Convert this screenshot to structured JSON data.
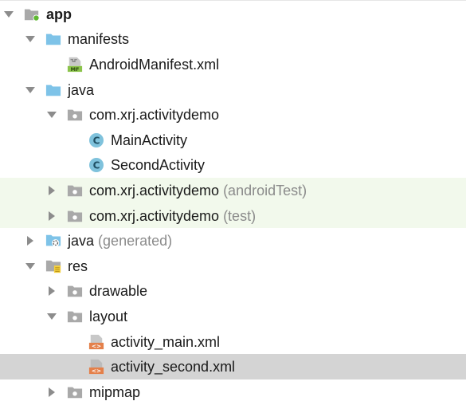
{
  "project_tree": {
    "root": {
      "label": "app"
    },
    "manifests": {
      "label": "manifests"
    },
    "android_manifest": {
      "label": "AndroidManifest.xml",
      "badge": "MF"
    },
    "java": {
      "label": "java"
    },
    "pkg_main": {
      "label": "com.xrj.activitydemo"
    },
    "main_activity": {
      "label": "MainActivity",
      "badge": "C"
    },
    "second_activity": {
      "label": "SecondActivity",
      "badge": "C"
    },
    "pkg_android_test": {
      "label": "com.xrj.activitydemo",
      "suffix": "(androidTest)"
    },
    "pkg_test": {
      "label": "com.xrj.activitydemo",
      "suffix": "(test)"
    },
    "java_generated": {
      "label": "java",
      "suffix": "(generated)"
    },
    "res": {
      "label": "res"
    },
    "drawable": {
      "label": "drawable"
    },
    "layout": {
      "label": "layout"
    },
    "activity_main_xml": {
      "label": "activity_main.xml",
      "badge": "<>"
    },
    "activity_second_xml": {
      "label": "activity_second.xml",
      "badge": "<>"
    },
    "mipmap": {
      "label": "mipmap"
    }
  },
  "colors": {
    "folder_blue": "#7ec3e8",
    "folder_gray": "#a9a9a9",
    "class_badge": "#7fc2dc",
    "xml_orange": "#e4804a",
    "manifest_green": "#8bc34a",
    "test_row_bg": "#f2f9ec",
    "selected_row_bg": "#d4d4d4",
    "suffix_gray": "#8b8b8b"
  }
}
